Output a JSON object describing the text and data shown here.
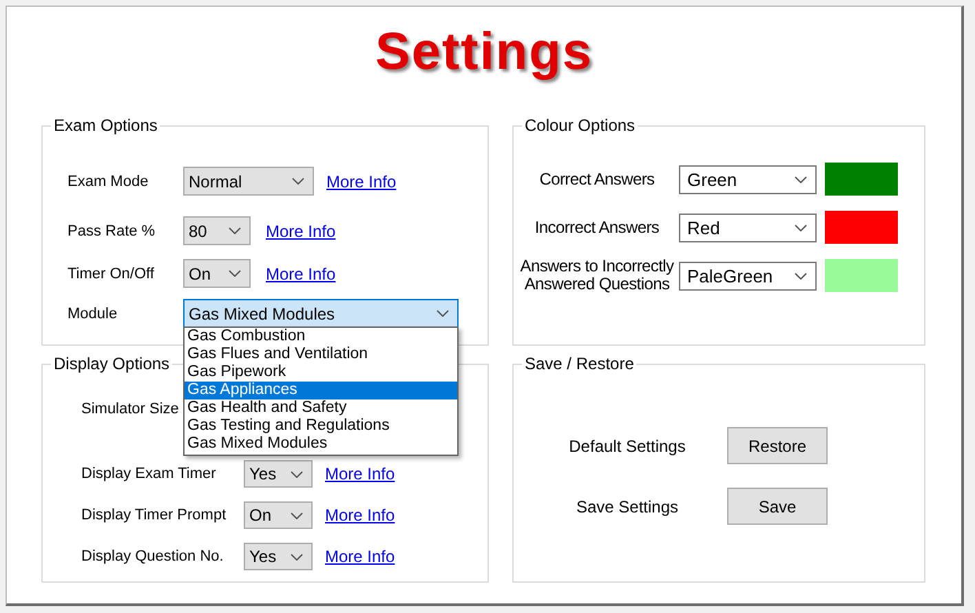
{
  "window": {
    "title": "Settings"
  },
  "exam_options": {
    "title": "Exam Options",
    "rows": [
      {
        "label": "Exam Mode",
        "value": "Normal",
        "link": "More Info"
      },
      {
        "label": "Pass Rate %",
        "value": "80",
        "link": "More Info"
      },
      {
        "label": "Timer On/Off",
        "value": "On",
        "link": "More Info"
      },
      {
        "label": "Module",
        "value": "Gas Mixed Modules",
        "focused": true,
        "expanded": true,
        "options": [
          {
            "label": "Gas Combustion",
            "highlighted": false
          },
          {
            "label": "Gas Flues and Ventilation",
            "highlighted": false
          },
          {
            "label": "Gas Pipework",
            "highlighted": false
          },
          {
            "label": "Gas Appliances",
            "highlighted": true
          },
          {
            "label": "Gas Health and Safety",
            "highlighted": false
          },
          {
            "label": "Gas Testing and Regulations",
            "highlighted": false
          },
          {
            "label": "Gas Mixed Modules",
            "highlighted": false
          }
        ]
      }
    ]
  },
  "display_options": {
    "title": "Display Options",
    "rows": [
      {
        "label": "Simulator Size"
      },
      {
        "label": "Display Exam Timer",
        "value": "Yes",
        "link": "More Info"
      },
      {
        "label": "Display Timer Prompt",
        "value": "On",
        "link": "More Info"
      },
      {
        "label": "Display Question No.",
        "value": "Yes",
        "link": "More Info"
      }
    ]
  },
  "colour_options": {
    "title": "Colour Options",
    "rows": [
      {
        "label": "Correct Answers",
        "value": "Green",
        "color": "#008000"
      },
      {
        "label": "Incorrect Answers",
        "value": "Red",
        "color": "#ff0000"
      },
      {
        "label": "Answers to Incorrectly Answered Questions",
        "value": "PaleGreen",
        "color": "#98fb98"
      }
    ]
  },
  "save_restore": {
    "title": "Save / Restore",
    "rows": [
      {
        "label": "Default Settings",
        "button": "Restore"
      },
      {
        "label": "Save Settings",
        "button": "Save"
      }
    ]
  }
}
